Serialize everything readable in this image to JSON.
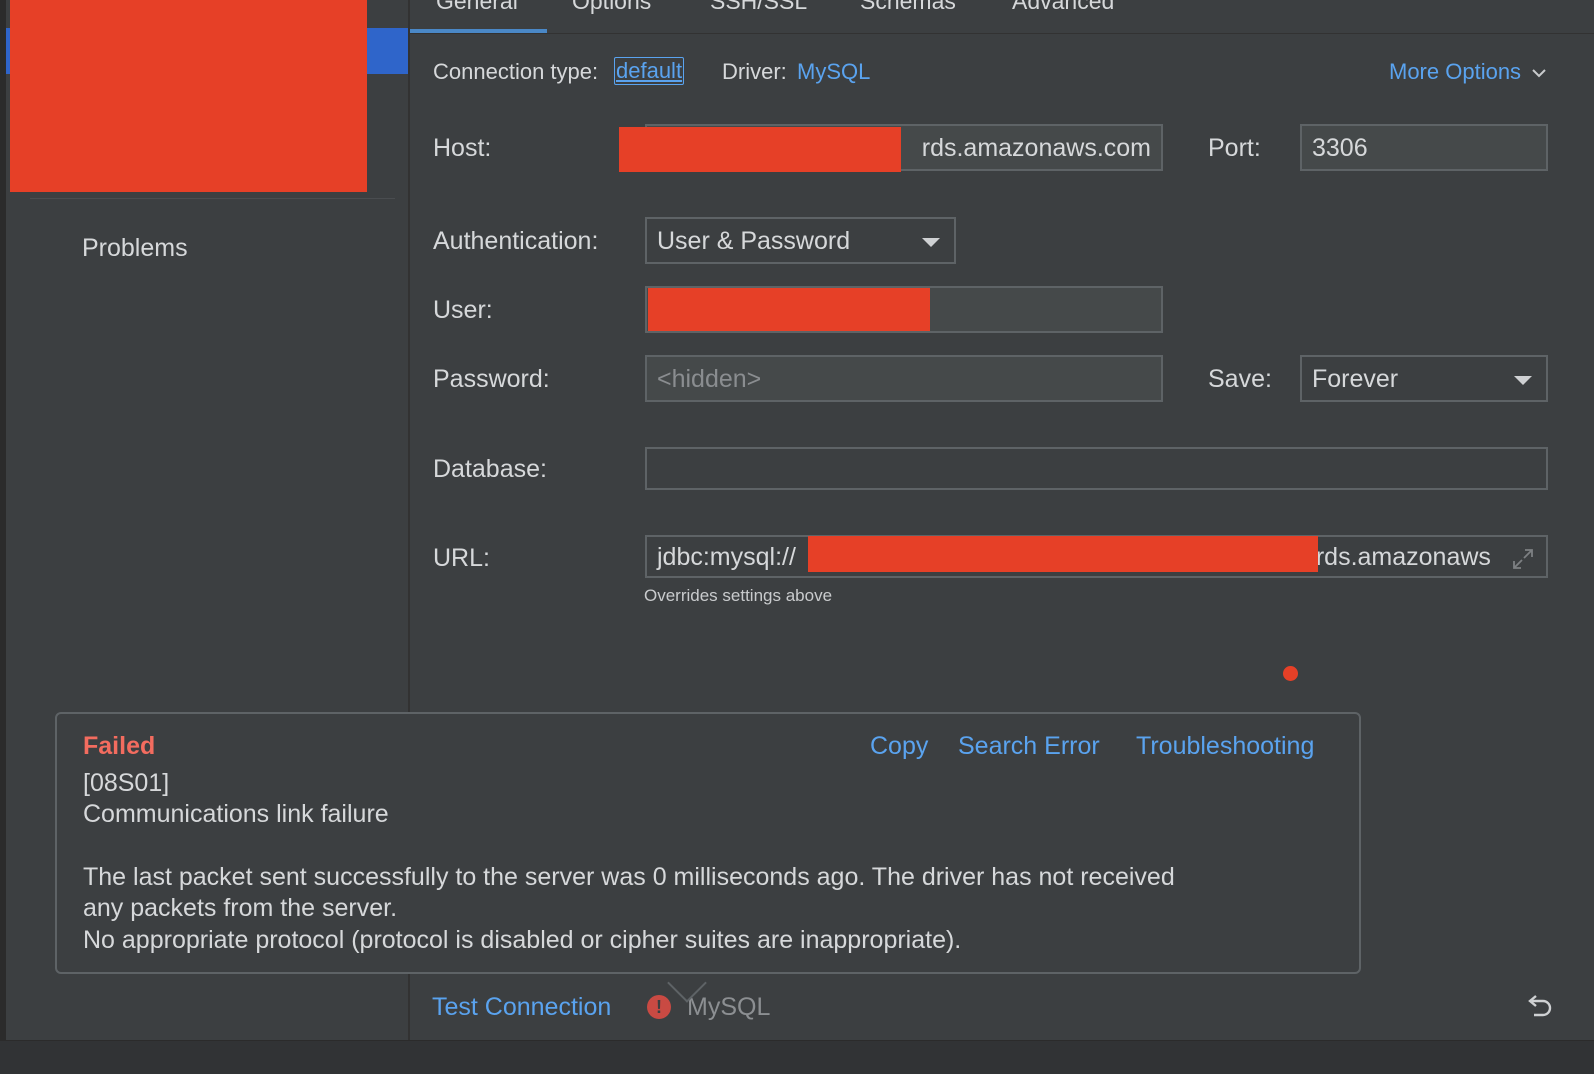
{
  "sidebar": {
    "problems_label": "Problems"
  },
  "tabs": [
    {
      "label": "General",
      "active": true
    },
    {
      "label": "Options"
    },
    {
      "label": "SSH/SSL"
    },
    {
      "label": "Schemas"
    },
    {
      "label": "Advanced"
    }
  ],
  "connection": {
    "type_label": "Connection type:",
    "type_value": "default",
    "driver_label": "Driver:",
    "driver_value": "MySQL",
    "more_options": "More Options"
  },
  "form": {
    "host_label": "Host:",
    "host_value": "rds.amazonaws.com",
    "port_label": "Port:",
    "port_value": "3306",
    "auth_label": "Authentication:",
    "auth_value": "User & Password",
    "user_label": "User:",
    "user_value": "",
    "password_label": "Password:",
    "password_placeholder": "<hidden>",
    "save_label": "Save:",
    "save_value": "Forever",
    "database_label": "Database:",
    "database_value": "",
    "url_label": "URL:",
    "url_prefix": "jdbc:mysql://",
    "url_suffix": "rds.amazonaws",
    "url_hint": "Overrides settings above"
  },
  "error_popup": {
    "status": "Failed",
    "code": "[08S01]",
    "title": "Communications link failure",
    "line1": "The last packet sent successfully to the server was 0 milliseconds ago. The driver has not received",
    "line2": "any packets from the server.",
    "line3": "No appropriate protocol (protocol is disabled or cipher suites are inappropriate).",
    "actions": [
      "Copy",
      "Search Error",
      "Troubleshooting"
    ]
  },
  "bottom": {
    "test_connection": "Test Connection",
    "status_driver": "MySQL"
  },
  "colors": {
    "background": "#3c3f41",
    "accent_link": "#5aa3ef",
    "error_red": "#f36c5f",
    "selection_blue": "#2f65ca",
    "redaction": "#e64027"
  }
}
